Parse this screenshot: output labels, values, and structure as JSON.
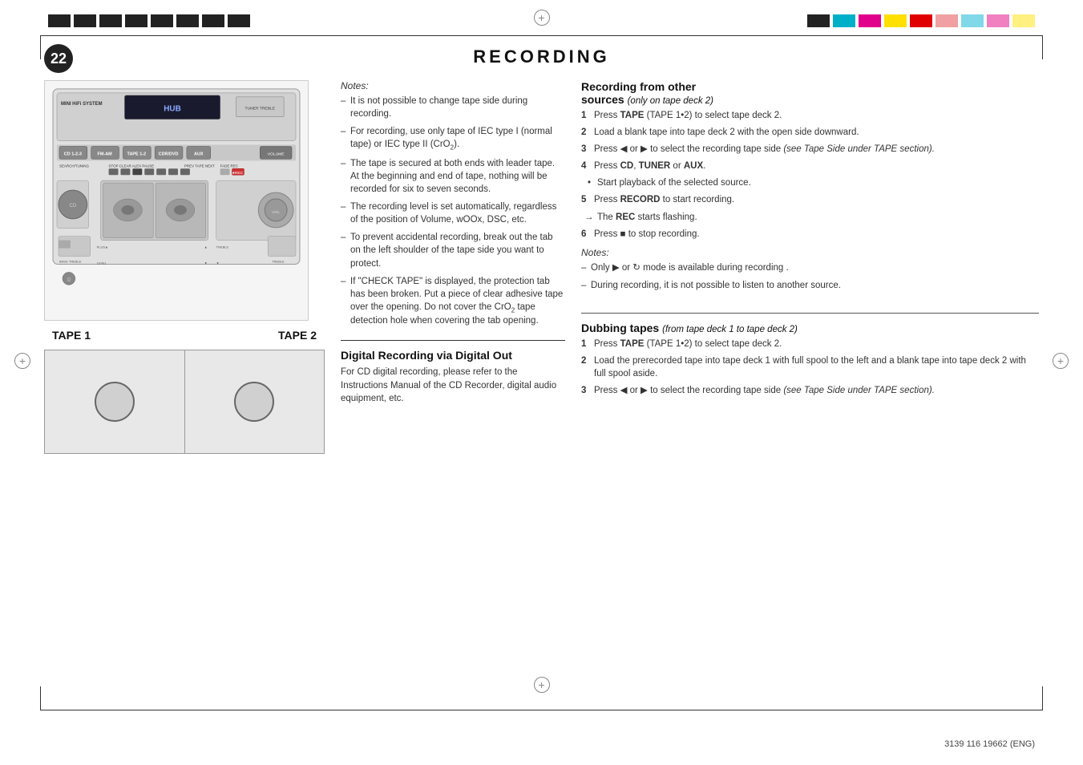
{
  "page": {
    "number": "22",
    "title": "RECORDING",
    "footer": "3139 116 19662 (ENG)"
  },
  "notes_label": "Notes:",
  "notes": [
    "It is not possible to change tape side during recording.",
    "For recording, use only tape of IEC type I (normal tape) or IEC type II (CrO₂).",
    "The tape is secured at both ends with leader tape. At the beginning and end of tape, nothing will be recorded for six to seven seconds.",
    "The recording level is set automatically, regardless of the position of Volume, wOOx, DSC, etc.",
    "To prevent accidental recording, break out the tab on the left shoulder of the tape side you want to protect.",
    "If \"CHECK TAPE\" is displayed, the protection tab has been broken. Put a piece of clear adhesive tape over the opening. Do not cover the CrO₂ tape detection hole when covering the tab opening."
  ],
  "digital_section": {
    "title": "Digital Recording via Digital Out",
    "body": "For CD digital recording, please refer to the Instructions Manual of the CD Recorder, digital audio equipment, etc."
  },
  "recording_from_other": {
    "title": "Recording from other",
    "subtitle": "sources",
    "subtitle_note": "(only on tape deck 2)",
    "steps": [
      {
        "num": "1",
        "text": "Press TAPE (TAPE 1•2) to select tape deck 2."
      },
      {
        "num": "2",
        "text": "Load a blank tape into tape deck 2 with the open side downward."
      },
      {
        "num": "3",
        "text": "Press ◀ or ▶ to select the recording tape side (see Tape Side under TAPE section)."
      },
      {
        "num": "4",
        "text": "Press CD, TUNER or AUX."
      },
      {
        "num": "",
        "text": "Start playback of the selected source.",
        "type": "bullet"
      },
      {
        "num": "5",
        "text": "Press RECORD to start recording."
      },
      {
        "num": "",
        "text": "The REC starts flashing.",
        "type": "arrow"
      },
      {
        "num": "6",
        "text": "Press ■ to stop recording."
      }
    ],
    "notes_label": "Notes:",
    "notes": [
      "Only ▶ or ↻ mode is available during recording.",
      "During recording, it is not possible to listen to another source."
    ]
  },
  "dubbing_section": {
    "title": "Dubbing tapes",
    "title_note": "(from tape deck 1 to tape deck 2)",
    "steps": [
      {
        "num": "1",
        "text": "Press TAPE (TAPE 1•2) to select tape deck 2."
      },
      {
        "num": "2",
        "text": "Load the prerecorded tape into tape deck 1 with full spool to the left and a blank tape into tape deck 2 with full spool aside."
      },
      {
        "num": "3",
        "text": "Press ◀ or ▶ to select the recording tape side (see Tape Side under TAPE section)."
      }
    ]
  },
  "tape_labels": {
    "tape1": "TAPE 1",
    "tape2": "TAPE 2"
  }
}
